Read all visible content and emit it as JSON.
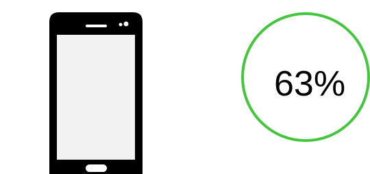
{
  "device": {
    "icon": "smartphone-icon",
    "body_color": "#000000",
    "screen_color": "#f2f2f2"
  },
  "indicator": {
    "value_text": "63%",
    "value": 63,
    "ring_color": "#44c63c"
  }
}
